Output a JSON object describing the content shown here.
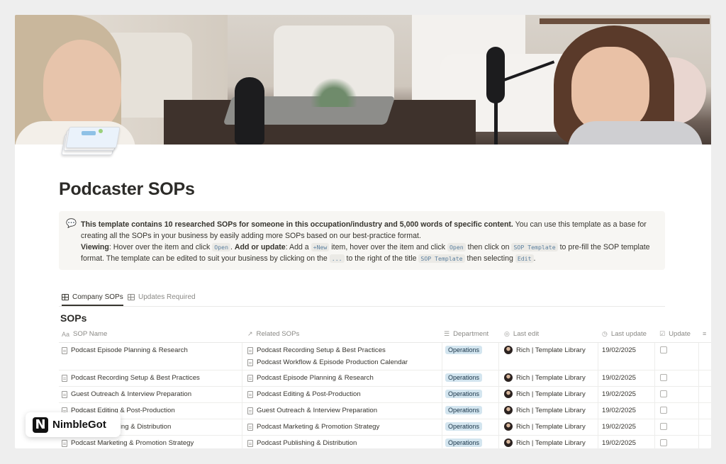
{
  "page": {
    "title": "Podcaster SOPs"
  },
  "callout": {
    "icon": "speech-bubble-icon",
    "bold_intro": "This template contains 10 researched SOPs for someone in this occupation/industry and 5,000 words of specific content.",
    "intro_rest": " You can use this template as a base for creating all the SOPs in your business by easily adding more SOPs based on our best-practice format.",
    "viewing_label": "Viewing",
    "viewing_text_1": ": Hover over the item and click ",
    "code_open": "Open",
    "add_label": "Add or update",
    "add_text_1": ": Add a ",
    "code_new": "+New",
    "add_text_2": " item, hover over the item and click ",
    "code_open2": "Open",
    "add_text_3": " then click on ",
    "code_template": "SOP Template",
    "add_text_4": " to pre-fill the SOP template format. The template can be edited to suit your business by clicking on the ",
    "code_dots": "...",
    "add_text_5": " to the right of the title ",
    "code_template2": "SOP Template",
    "add_text_6": " then selecting ",
    "code_edit": "Edit",
    "add_text_7": "."
  },
  "tabs": [
    {
      "label": "Company SOPs",
      "icon": "table-icon",
      "active": true
    },
    {
      "label": "Updates Required",
      "icon": "table-icon",
      "active": false
    }
  ],
  "database": {
    "title": "SOPs",
    "columns": [
      {
        "label": "SOP Name",
        "icon": "Aa"
      },
      {
        "label": "Related SOPs",
        "icon": "↗"
      },
      {
        "label": "Department",
        "icon": "☰"
      },
      {
        "label": "Last edit",
        "icon": "◎"
      },
      {
        "label": "Last update",
        "icon": "◷"
      },
      {
        "label": "Update",
        "icon": "☑"
      },
      {
        "label": "",
        "icon": "≡"
      }
    ],
    "rows": [
      {
        "name": "Podcast Episode Planning & Research",
        "related": [
          "Podcast Recording Setup & Best Practices",
          "Podcast Workflow & Episode Production Calendar"
        ],
        "department": "Operations",
        "editor": "Rich | Template Library",
        "date": "19/02/2025"
      },
      {
        "name": "Podcast Recording Setup & Best Practices",
        "related": [
          "Podcast Episode Planning & Research"
        ],
        "department": "Operations",
        "editor": "Rich | Template Library",
        "date": "19/02/2025"
      },
      {
        "name": "Guest Outreach & Interview Preparation",
        "related": [
          "Podcast Editing & Post-Production"
        ],
        "department": "Operations",
        "editor": "Rich | Template Library",
        "date": "19/02/2025"
      },
      {
        "name": "Podcast Editing & Post-Production",
        "related": [
          "Guest Outreach & Interview Preparation"
        ],
        "department": "Operations",
        "editor": "Rich | Template Library",
        "date": "19/02/2025"
      },
      {
        "name": "Podcast Publishing & Distribution",
        "related": [
          "Podcast Marketing & Promotion Strategy"
        ],
        "department": "Operations",
        "editor": "Rich | Template Library",
        "date": "19/02/2025"
      },
      {
        "name": "Podcast Marketing & Promotion Strategy",
        "related": [
          "Podcast Publishing & Distribution"
        ],
        "department": "Operations",
        "editor": "Rich | Template Library",
        "date": "19/02/2025"
      }
    ]
  },
  "brand": {
    "logo_letter": "N",
    "name": "NimbleGot"
  }
}
